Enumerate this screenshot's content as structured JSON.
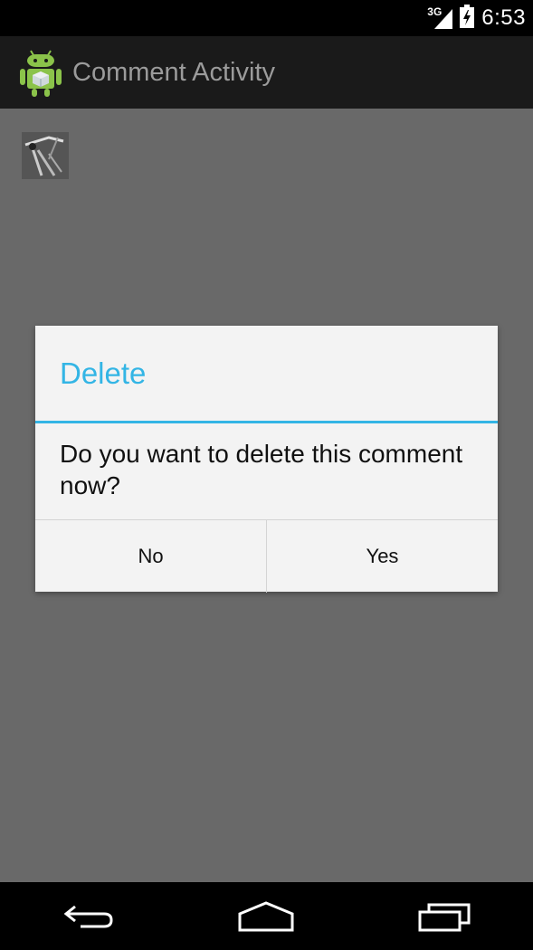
{
  "status_bar": {
    "network_label": "3G",
    "time": "6:53",
    "icons": [
      "signal-icon",
      "battery-icon"
    ]
  },
  "action_bar": {
    "title": "Comment Activity",
    "icon": "android-robot-icon"
  },
  "content": {
    "thumbnail": "comment-thumbnail"
  },
  "dialog": {
    "title": "Delete",
    "message": "Do you want to delete this comment now?",
    "negative_button": "No",
    "positive_button": "Yes",
    "accent_color": "#33b5e5"
  },
  "nav_bar": {
    "icons": [
      "back-icon",
      "home-icon",
      "recent-apps-icon"
    ]
  }
}
